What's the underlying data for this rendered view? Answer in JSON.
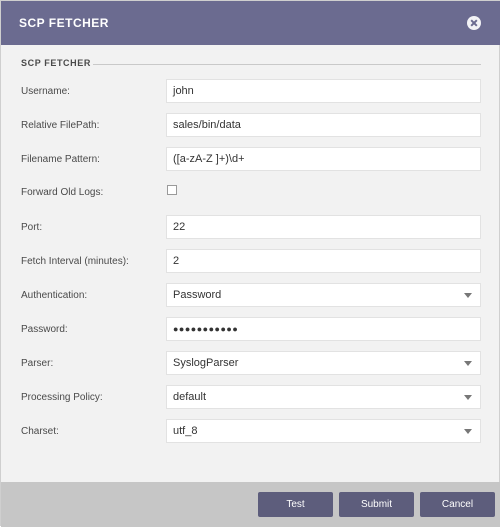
{
  "dialog": {
    "title": "SCP FETCHER",
    "section_title": "SCP FETCHER"
  },
  "fields": {
    "username": {
      "label": "Username:",
      "value": "john"
    },
    "relative_filepath": {
      "label": "Relative FilePath:",
      "value": "sales/bin/data"
    },
    "filename_pattern": {
      "label": "Filename Pattern:",
      "value": "([a-zA-Z ]+)\\d+"
    },
    "forward_old_logs": {
      "label": "Forward Old Logs:",
      "checked": false
    },
    "port": {
      "label": "Port:",
      "value": "22"
    },
    "fetch_interval": {
      "label": "Fetch Interval (minutes):",
      "value": "2"
    },
    "authentication": {
      "label": "Authentication:",
      "value": "Password"
    },
    "password": {
      "label": "Password:",
      "value": "●●●●●●●●●●●"
    },
    "parser": {
      "label": "Parser:",
      "value": "SyslogParser"
    },
    "processing_policy": {
      "label": "Processing Policy:",
      "value": "default"
    },
    "charset": {
      "label": "Charset:",
      "value": "utf_8"
    }
  },
  "buttons": {
    "test": "Test",
    "submit": "Submit",
    "cancel": "Cancel"
  },
  "icons": {
    "close": "close-icon",
    "dropdown": "chevron-down-icon"
  },
  "colors": {
    "header": "#6b6b90",
    "button": "#5d5d7c",
    "footer": "#c6c6c6",
    "body": "#f2f2f2"
  }
}
